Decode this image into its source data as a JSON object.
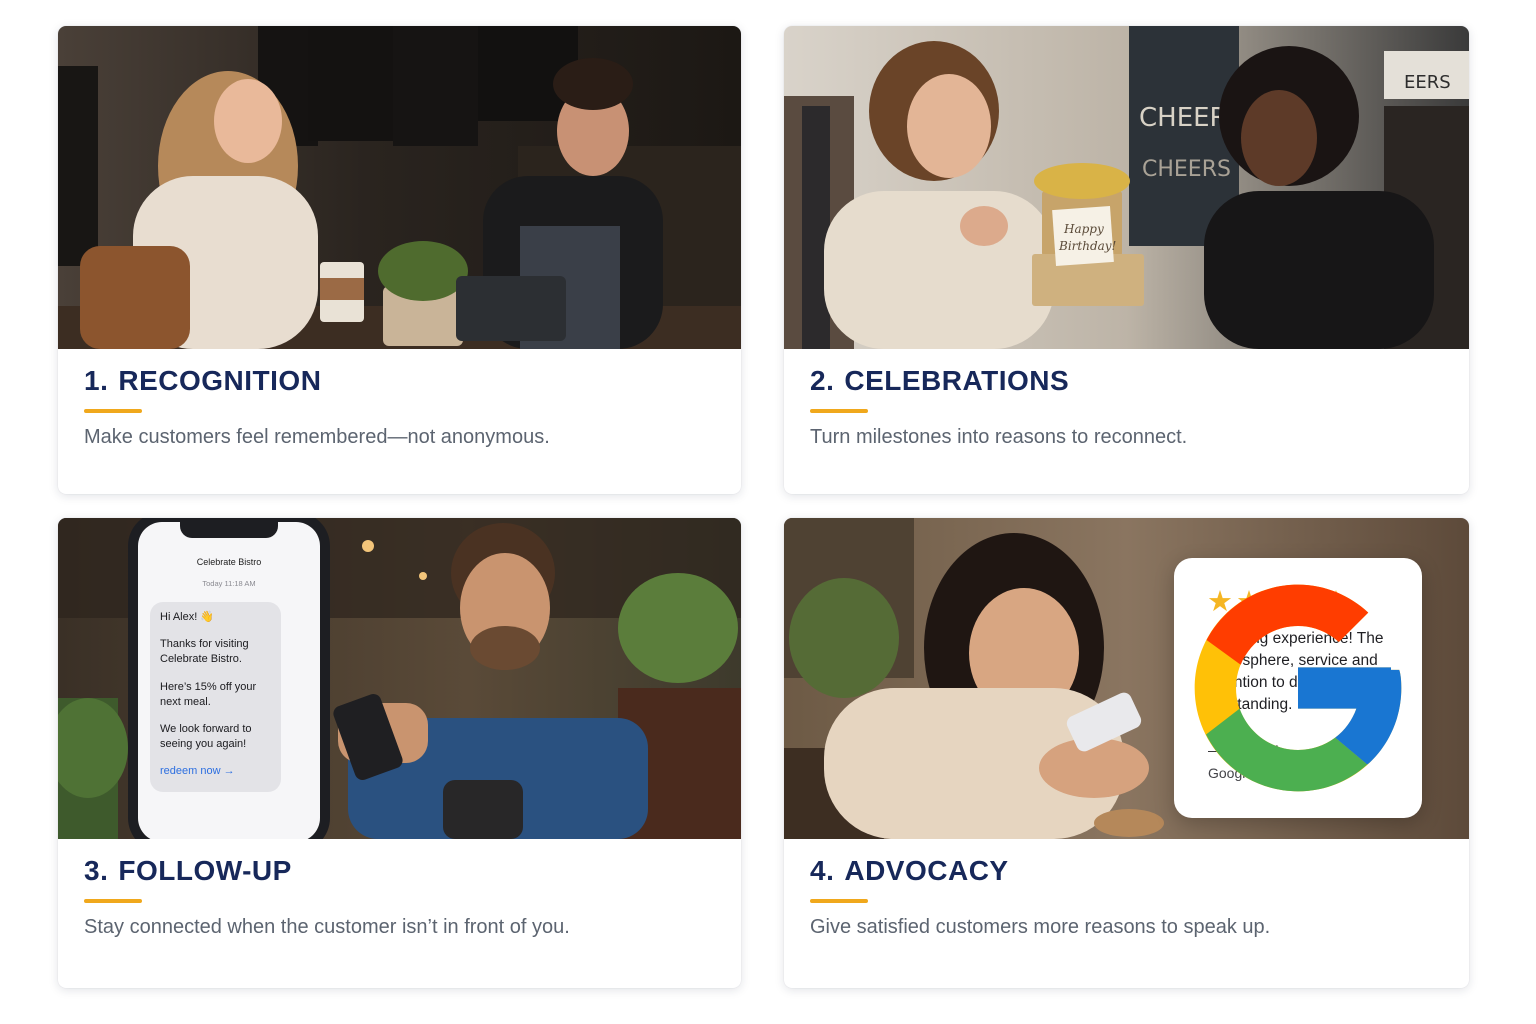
{
  "cards": [
    {
      "number": "1.",
      "title": "RECOGNITION",
      "description": "Make customers feel remembered—not anonymous.",
      "photo": "cafe-barista-greeting-customer"
    },
    {
      "number": "2.",
      "title": "CELEBRATIONS",
      "description": "Turn milestones into reasons to reconnect.",
      "photo": "boutique-birthday-gift",
      "photo_text": {
        "gift_tag_line1": "Happy",
        "gift_tag_line2": "Birthday!",
        "store_sign_1": "CHEERS",
        "store_sign_2": "CHEERS",
        "store_sign_3": "EERS"
      }
    },
    {
      "number": "3.",
      "title": "FOLLOW-UP",
      "description": "Stay connected when the customer isn’t in front of you.",
      "photo": "man-reading-text-message-in-cafe",
      "phone": {
        "contact": "Celebrate Bistro",
        "timestamp": "Today 11:18 AM",
        "greeting": "Hi Alex! 👋",
        "line1": "Thanks for visiting Celebrate Bistro.",
        "line2": "Here’s 15% off your next meal.",
        "line3": "We look forward to seeing you again!",
        "link": "redeem now →"
      }
    },
    {
      "number": "4.",
      "title": "ADVOCACY",
      "description": "Give satisfied customers more reasons to speak up.",
      "photo": "woman-smiling-at-phone-in-cafe",
      "review": {
        "stars": "★★★★★",
        "rating": 5,
        "text": "Amazing experience! The atmosphere, service and attention to detail were outstanding.",
        "author": "— Sarah M.",
        "source": "Google Review",
        "logo_icon": "google-g-icon"
      }
    }
  ],
  "colors": {
    "title": "#17285a",
    "accent": "#f0a81c",
    "description": "#5c6470",
    "star": "#f5b623",
    "link": "#2d6fe0"
  }
}
